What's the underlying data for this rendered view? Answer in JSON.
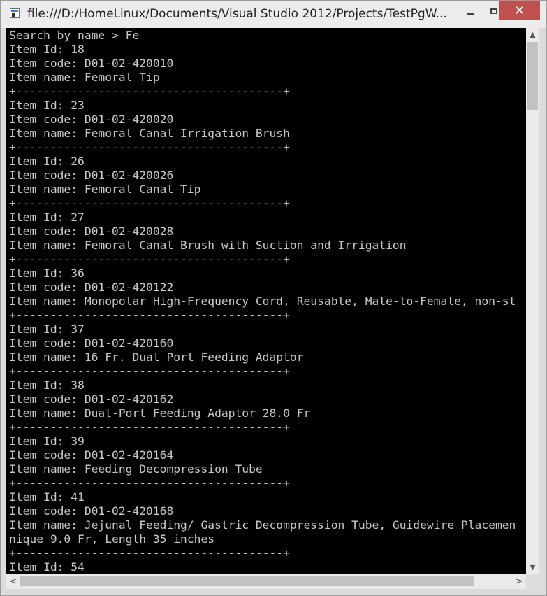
{
  "window": {
    "title": "file:///D:/HomeLinux/Documents/Visual Studio 2012/Projects/TestPgW...",
    "close_glyph": "✕"
  },
  "console": {
    "lines": [
      "Search by name > Fe",
      "Item Id: 18",
      "Item code: D01-02-420010",
      "Item name: Femoral Tip",
      "+---------------------------------------+",
      "Item Id: 23",
      "Item code: D01-02-420020",
      "Item name: Femoral Canal Irrigation Brush",
      "+---------------------------------------+",
      "Item Id: 26",
      "Item code: D01-02-420026",
      "Item name: Femoral Canal Tip",
      "+---------------------------------------+",
      "Item Id: 27",
      "Item code: D01-02-420028",
      "Item name: Femoral Canal Brush with Suction and Irrigation",
      "+---------------------------------------+",
      "Item Id: 36",
      "Item code: D01-02-420122",
      "Item name: Monopolar High-Frequency Cord, Reusable, Male-to-Female, non-st",
      "+---------------------------------------+",
      "Item Id: 37",
      "Item code: D01-02-420160",
      "Item name: 16 Fr. Dual Port Feeding Adaptor",
      "+---------------------------------------+",
      "Item Id: 38",
      "Item code: D01-02-420162",
      "Item name: Dual-Port Feeding Adaptor 28.0 Fr",
      "+---------------------------------------+",
      "Item Id: 39",
      "Item code: D01-02-420164",
      "Item name: Feeding Decompression Tube",
      "+---------------------------------------+",
      "Item Id: 41",
      "Item code: D01-02-420168",
      "Item name: Jejunal Feeding/ Gastric Decompression Tube, Guidewire Placemen",
      "nique 9.0 Fr, Length 35 inches",
      "+---------------------------------------+",
      "Item Id: 54"
    ]
  },
  "scrollbars": {
    "up_glyph": "▲",
    "down_glyph": "▼",
    "left_glyph": "<",
    "right_glyph": ">"
  },
  "colors": {
    "console_bg": "#000000",
    "console_text": "#c8c8c8",
    "close_button": "#c0504d"
  }
}
